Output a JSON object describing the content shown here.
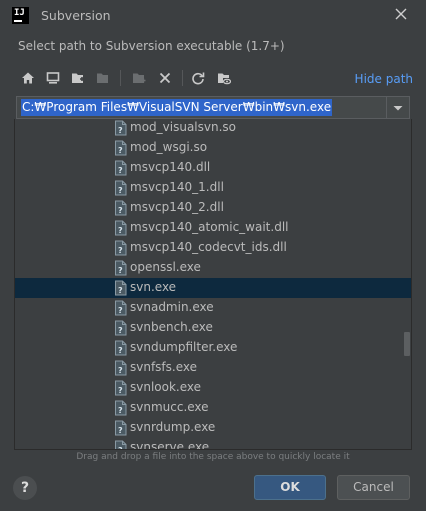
{
  "window": {
    "title": "Subversion",
    "app_icon_text": "IJ"
  },
  "subtitle": "Select path to Subversion executable (1.7+)",
  "toolbar": {
    "icons": [
      "home-icon",
      "desktop-icon",
      "new-folder-icon",
      "folder-disabled-icon",
      "new-folder-disabled-icon",
      "delete-icon",
      "refresh-icon",
      "show-hidden-icon"
    ],
    "hide_path_label": "Hide path"
  },
  "path_field": {
    "value": "C:₩Program Files₩VisualSVN Server₩bin₩svn.exe"
  },
  "files": [
    {
      "name": "mod_visualsvn.so"
    },
    {
      "name": "mod_wsgi.so"
    },
    {
      "name": "msvcp140.dll"
    },
    {
      "name": "msvcp140_1.dll"
    },
    {
      "name": "msvcp140_2.dll"
    },
    {
      "name": "msvcp140_atomic_wait.dll"
    },
    {
      "name": "msvcp140_codecvt_ids.dll"
    },
    {
      "name": "openssl.exe"
    },
    {
      "name": "svn.exe",
      "selected": true
    },
    {
      "name": "svnadmin.exe"
    },
    {
      "name": "svnbench.exe"
    },
    {
      "name": "svndumpfilter.exe"
    },
    {
      "name": "svnfsfs.exe"
    },
    {
      "name": "svnlook.exe"
    },
    {
      "name": "svnmucc.exe"
    },
    {
      "name": "svnrdump.exe"
    },
    {
      "name": "svnserve.exe"
    }
  ],
  "hint": "Drag and drop a file into the space above to quickly locate it",
  "buttons": {
    "help": "?",
    "ok": "OK",
    "cancel": "Cancel"
  }
}
